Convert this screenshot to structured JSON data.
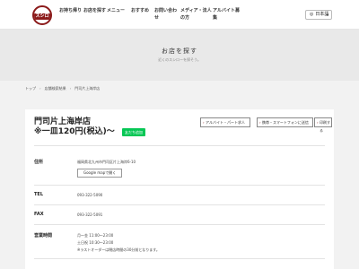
{
  "header": {
    "logo_text": "スシロー",
    "nav": [
      "お持ち帰り",
      "お店を探す",
      "メニュー",
      "おすすめ",
      "お問い合わせ",
      "メディア・法人の方",
      "アルバイト募集"
    ],
    "language": "日本語"
  },
  "hero": {
    "title": "お店を探す",
    "subtitle": "近くのスシローを探そう。"
  },
  "breadcrumb": {
    "items": [
      "トップ",
      "店舗検索結果",
      "門司片上海岸店"
    ]
  },
  "store": {
    "name": "門司片上海岸店",
    "price": "※一皿120円(税込)〜",
    "line_badge": "友だち追加",
    "buttons": {
      "parttime": "アルバイト・パート求人",
      "mobile": "携帯・スマートフォンに送信",
      "print": "印刷する"
    },
    "address_label": "住所",
    "address": "福岡県北九州市門司区片上海岸6-10",
    "map_button": "Google mapで開く",
    "tel_label": "TEL",
    "tel": "093-322-5090",
    "fax_label": "FAX",
    "fax": "093-322-5091",
    "hours_label": "営業時間",
    "hours": [
      "月～金 11:00〜23:00",
      "土日祝 10:30〜23:00",
      "※ラストオーダーは閉店時間の30分前となります。"
    ]
  },
  "colors": {
    "brand": "#8b1a1a",
    "line": "#06c755"
  }
}
